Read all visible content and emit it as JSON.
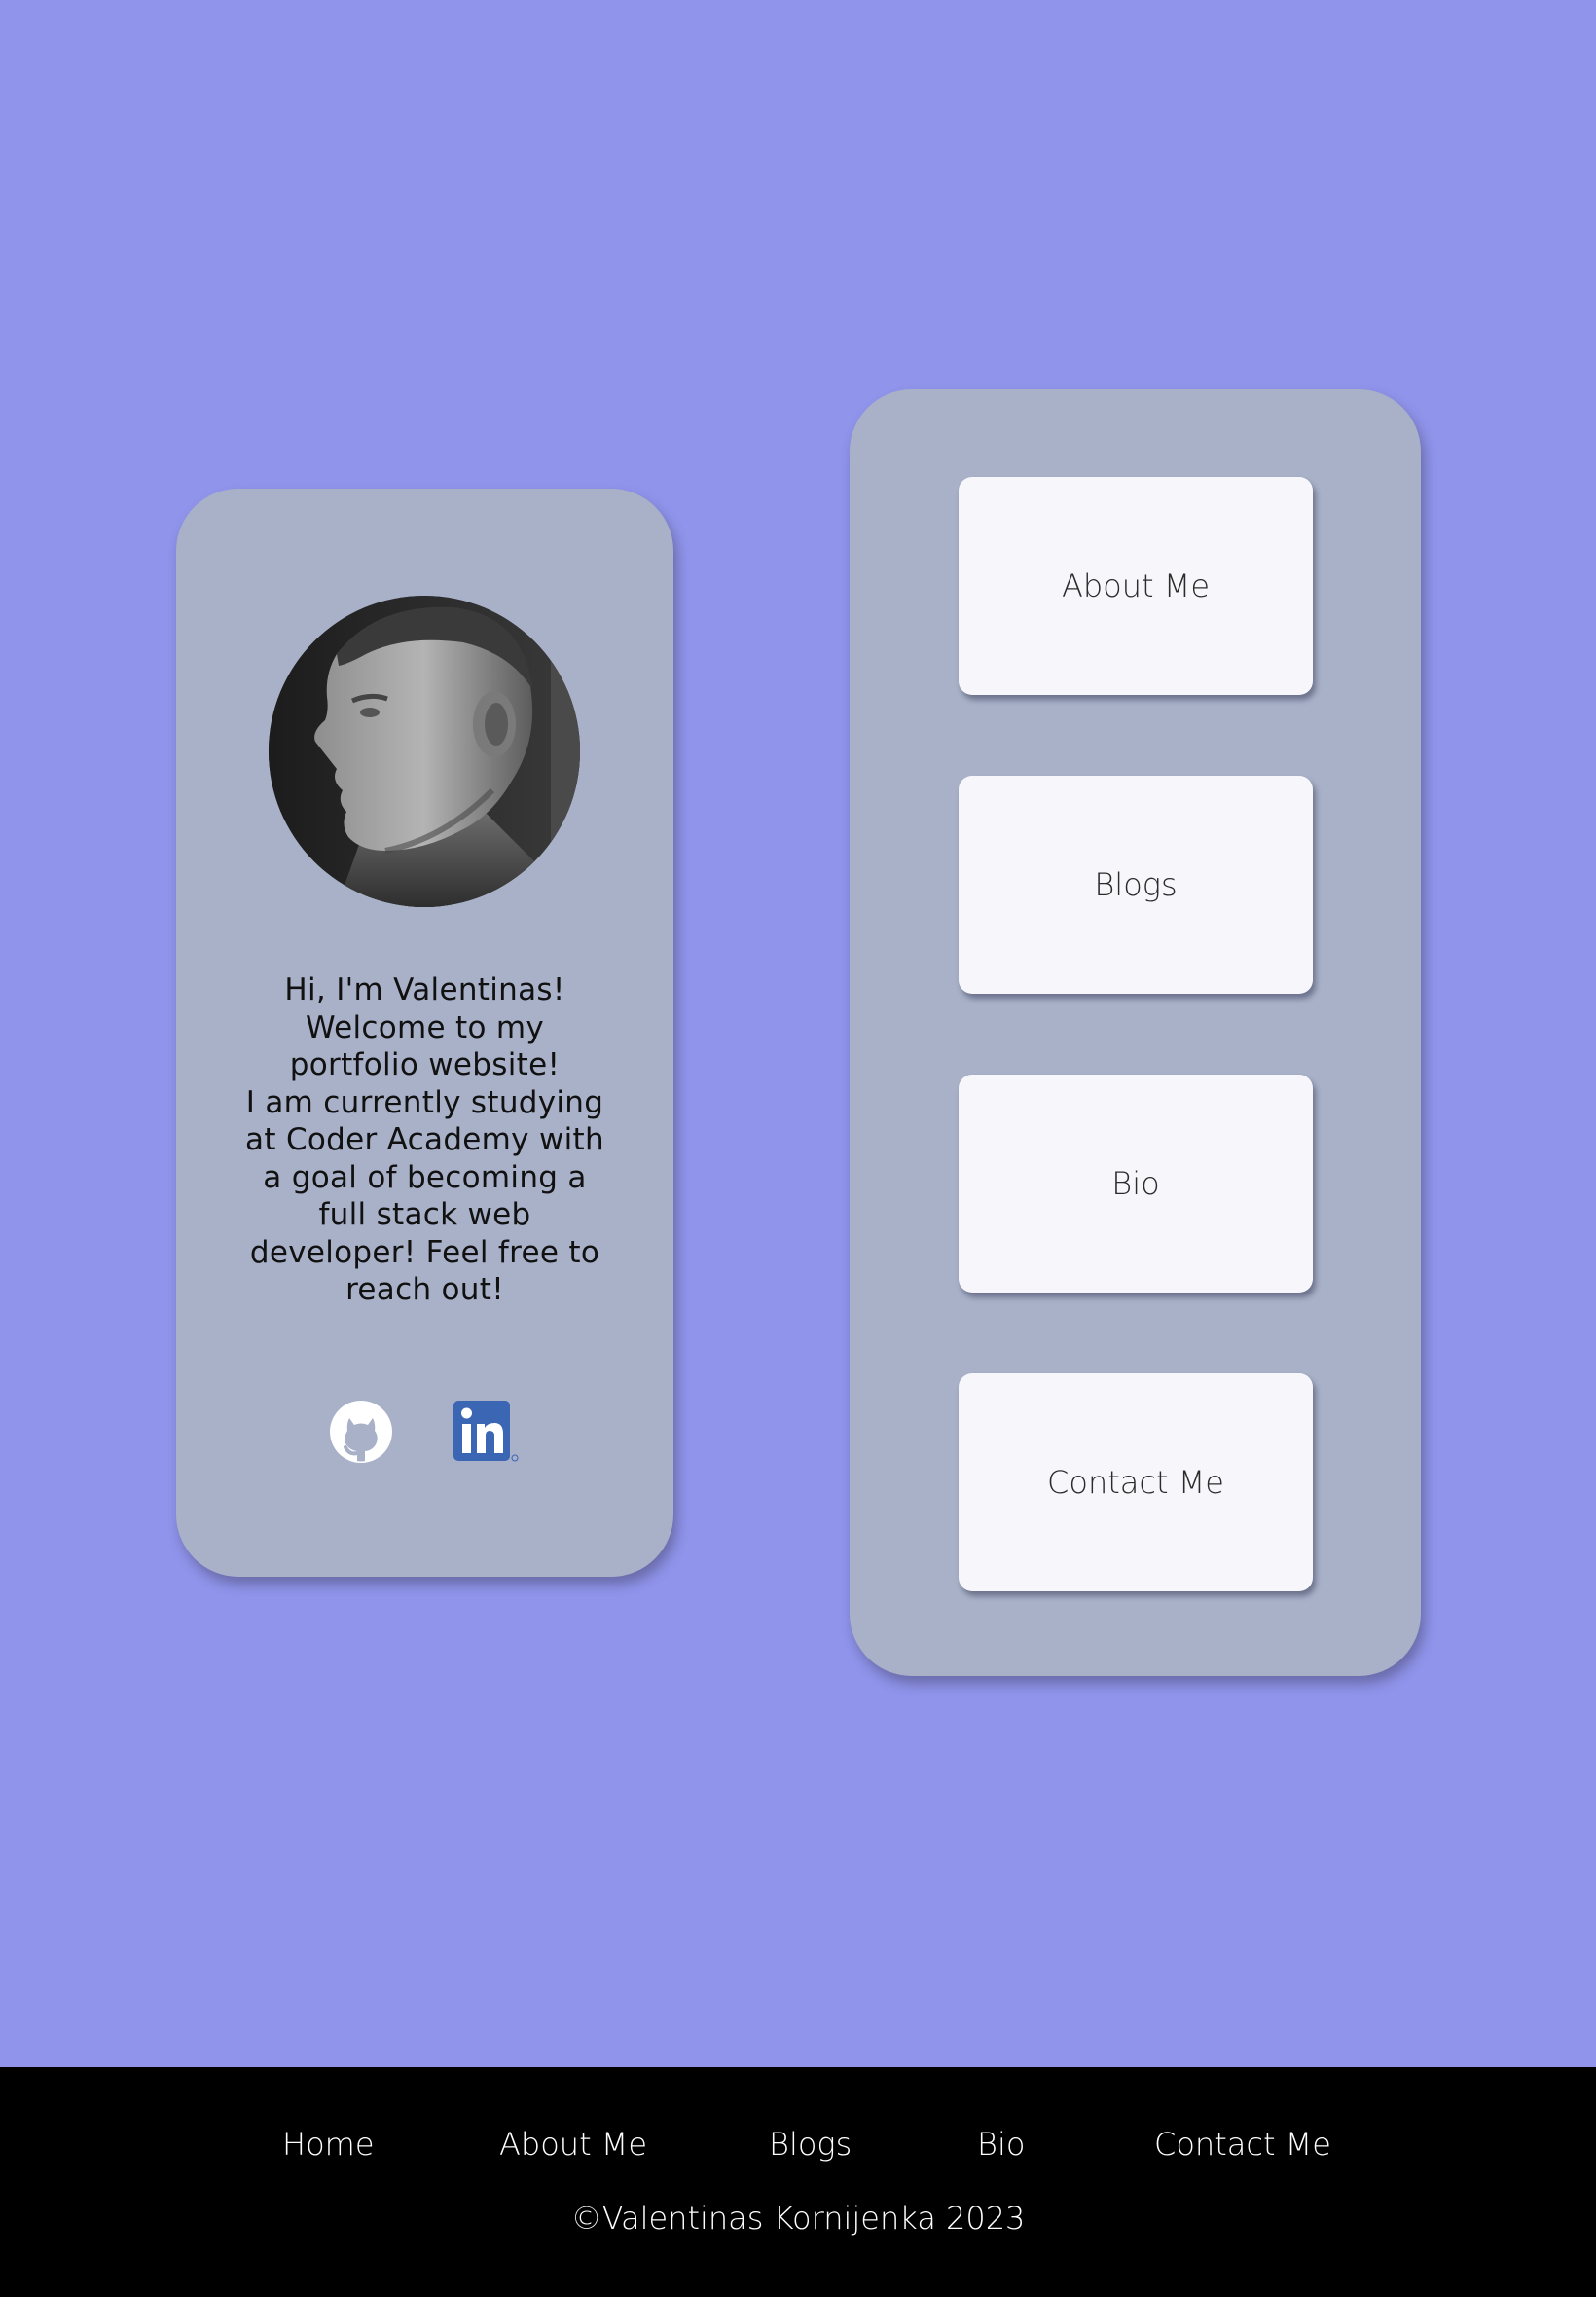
{
  "profile": {
    "avatar_alt": "portrait-photo",
    "bio_lines": [
      "Hi, I'm Valentinas!",
      "Welcome to my",
      "portfolio website!",
      "I am currently studying",
      "at Coder Academy with",
      "a goal of becoming a",
      "full stack web",
      "developer! Feel free to",
      "reach out!"
    ],
    "social_icons": [
      "github-icon",
      "linkedin-icon"
    ]
  },
  "nav_buttons": [
    {
      "label": "About Me"
    },
    {
      "label": "Blogs"
    },
    {
      "label": "Bio"
    },
    {
      "label": "Contact Me"
    }
  ],
  "footer": {
    "links": [
      "Home",
      "About Me",
      "Blogs",
      "Bio",
      "Contact Me"
    ],
    "copyright": "©Valentinas Kornijenka 2023"
  },
  "colors": {
    "page_background": "#9094eb",
    "card_background": "#a8b1c8",
    "button_background": "#f7f7fb",
    "footer_background": "#000000",
    "linkedin_blue": "#3b66b4"
  }
}
